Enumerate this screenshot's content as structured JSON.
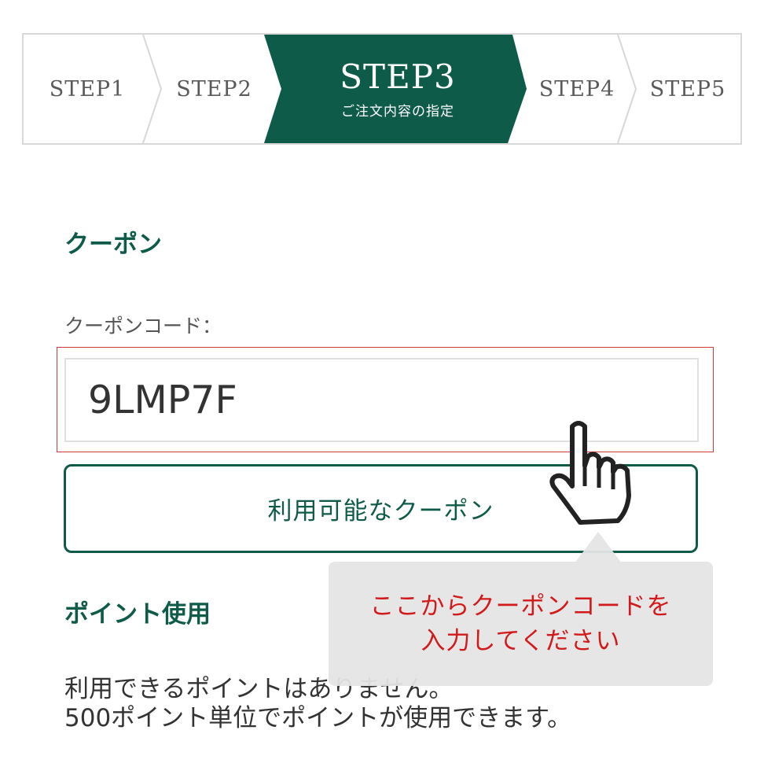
{
  "steps": [
    {
      "label": "STEP1"
    },
    {
      "label": "STEP2"
    },
    {
      "label": "STEP3",
      "sub": "ご注文内容の指定"
    },
    {
      "label": "STEP4"
    },
    {
      "label": "STEP5"
    }
  ],
  "colors": {
    "accent": "#0f5b49",
    "tooltip_text": "#d31a1a",
    "frame_highlight": "#d23a3a"
  },
  "coupon": {
    "heading": "クーポン",
    "label": "クーポンコード：",
    "code_value": "9LMP7F",
    "button_label": "利用可能なクーポン"
  },
  "points": {
    "heading": "ポイント使用",
    "line1": "利用できるポイントはありません。",
    "line2": "500ポイント単位でポイントが使用できます。"
  },
  "tooltip": {
    "line1": "ここからクーポンコードを",
    "line2": "入力してください"
  },
  "icons": {
    "pointer": "hand-pointer-icon"
  }
}
